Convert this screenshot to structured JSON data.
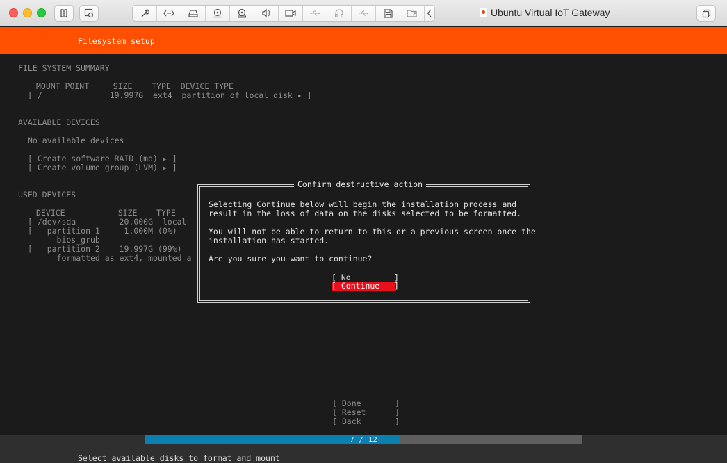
{
  "window": {
    "title": "Ubuntu Virtual IoT Gateway",
    "toolbar_icons": [
      "wrench-icon",
      "code-brackets-icon",
      "hard-drive-icon",
      "cd-drive-icon",
      "optical-disc-icon",
      "speaker-icon",
      "camera-icon",
      "usb-icon",
      "headphones-icon",
      "usb-icon",
      "floppy-icon",
      "shared-folder-icon",
      "chevron-left-icon"
    ]
  },
  "header": {
    "title": "Filesystem setup"
  },
  "summary": {
    "heading": "FILE SYSTEM SUMMARY",
    "columns": "MOUNT POINT     SIZE    TYPE  DEVICE TYPE",
    "row": "[ /              19.997G  ext4  partition of local disk ▸ ]"
  },
  "available": {
    "heading": "AVAILABLE DEVICES",
    "empty": "No available devices",
    "actions": [
      "[ Create software RAID (md) ▸ ]",
      "[ Create volume group (LVM) ▸ ]"
    ]
  },
  "used": {
    "heading": "USED DEVICES",
    "columns": "DEVICE           SIZE    TYPE",
    "rows": [
      "[ /dev/sda         20.000G  local",
      "[   partition 1     1.000M (0%)",
      "      bios_grub",
      "[   partition 2    19.997G (99%)",
      "      formatted as ext4, mounted a"
    ]
  },
  "dialog": {
    "title": "Confirm destructive action",
    "lines": [
      "Selecting Continue below will begin the installation process and",
      "result in the loss of data on the disks selected to be formatted.",
      "You will not be able to return to this or a previous screen once the",
      "installation has started.",
      "Are you sure you want to continue?"
    ],
    "no_label": "[ No         ]",
    "continue_label": "[ Continue   ]"
  },
  "bottom_buttons": [
    "[ Done       ]",
    "[ Reset      ]",
    "[ Back       ]"
  ],
  "progress": {
    "label": "7 / 12",
    "current": 7,
    "total": 12
  },
  "footer": {
    "hint": "Select available disks to format and mount"
  }
}
